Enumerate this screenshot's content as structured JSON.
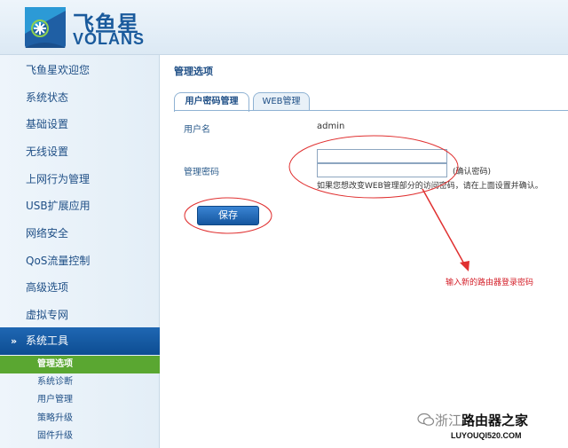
{
  "brand": {
    "name_cn": "飞鱼星",
    "name_en": "VOLANS"
  },
  "sidebar": {
    "items": [
      {
        "label": "飞鱼星欢迎您"
      },
      {
        "label": "系统状态"
      },
      {
        "label": "基础设置"
      },
      {
        "label": "无线设置"
      },
      {
        "label": "上网行为管理"
      },
      {
        "label": "USB扩展应用"
      },
      {
        "label": "网络安全"
      },
      {
        "label": "QoS流量控制"
      },
      {
        "label": "高级选项"
      },
      {
        "label": "虚拟专网"
      }
    ],
    "active_section": {
      "label": "系统工具",
      "chevron": "»"
    },
    "sub_items": [
      {
        "label": "管理选项",
        "active": true
      },
      {
        "label": "系统诊断"
      },
      {
        "label": "用户管理"
      },
      {
        "label": "策略升级"
      },
      {
        "label": "固件升级"
      }
    ]
  },
  "main": {
    "title": "管理选项",
    "tabs": [
      {
        "label": "用户密码管理",
        "active": true
      },
      {
        "label": "WEB管理",
        "active": false
      }
    ],
    "form": {
      "username_label": "用户名",
      "username_value": "admin",
      "password_label": "管理密码",
      "confirm_label": "(确认密码)",
      "hint": "如果您想改变WEB管理部分的访问密码，请在上面设置并确认。",
      "password_value": "",
      "confirm_value": ""
    },
    "save_label": "保存"
  },
  "annotation": {
    "text": "输入新的路由器登录密码",
    "color": "#d4202a"
  },
  "watermark": {
    "prefix": "浙江",
    "text": "路由器之家",
    "url": "LUYOUQI520.COM"
  },
  "colors": {
    "nav_text": "#1f4f86",
    "active_nav_bg": "#0d4d92",
    "active_sub_bg": "#5aa731"
  }
}
